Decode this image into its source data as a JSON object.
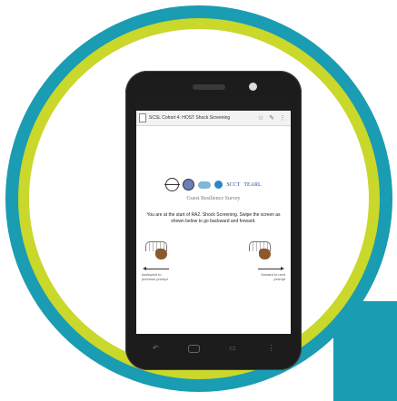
{
  "colors": {
    "ring_outer": "#1a9cb2",
    "ring_mid": "#c9d82a",
    "phone": "#1c1c1c"
  },
  "status_bar": {
    "left": "",
    "right": ""
  },
  "browser": {
    "tab_title": "SCSL Cohort 4: HOST Shock Screening",
    "icons": [
      "document-icon",
      "star-icon",
      "edit-icon",
      "menu-icon"
    ]
  },
  "logos": {
    "scct_text": "SCCT",
    "tear_text": "TEARL"
  },
  "survey_title": "Guest Resilience Survey",
  "intro_text": "You are at the start of RA2. Shock Screening. Swipe the screen as shown below to go backward and forward.",
  "nav": {
    "left_label": "backward to previous prompt",
    "right_label": "forward to next prompt"
  },
  "system_nav": {
    "icons": [
      "back-icon",
      "home-icon",
      "recents-icon",
      "menu-icon"
    ]
  }
}
